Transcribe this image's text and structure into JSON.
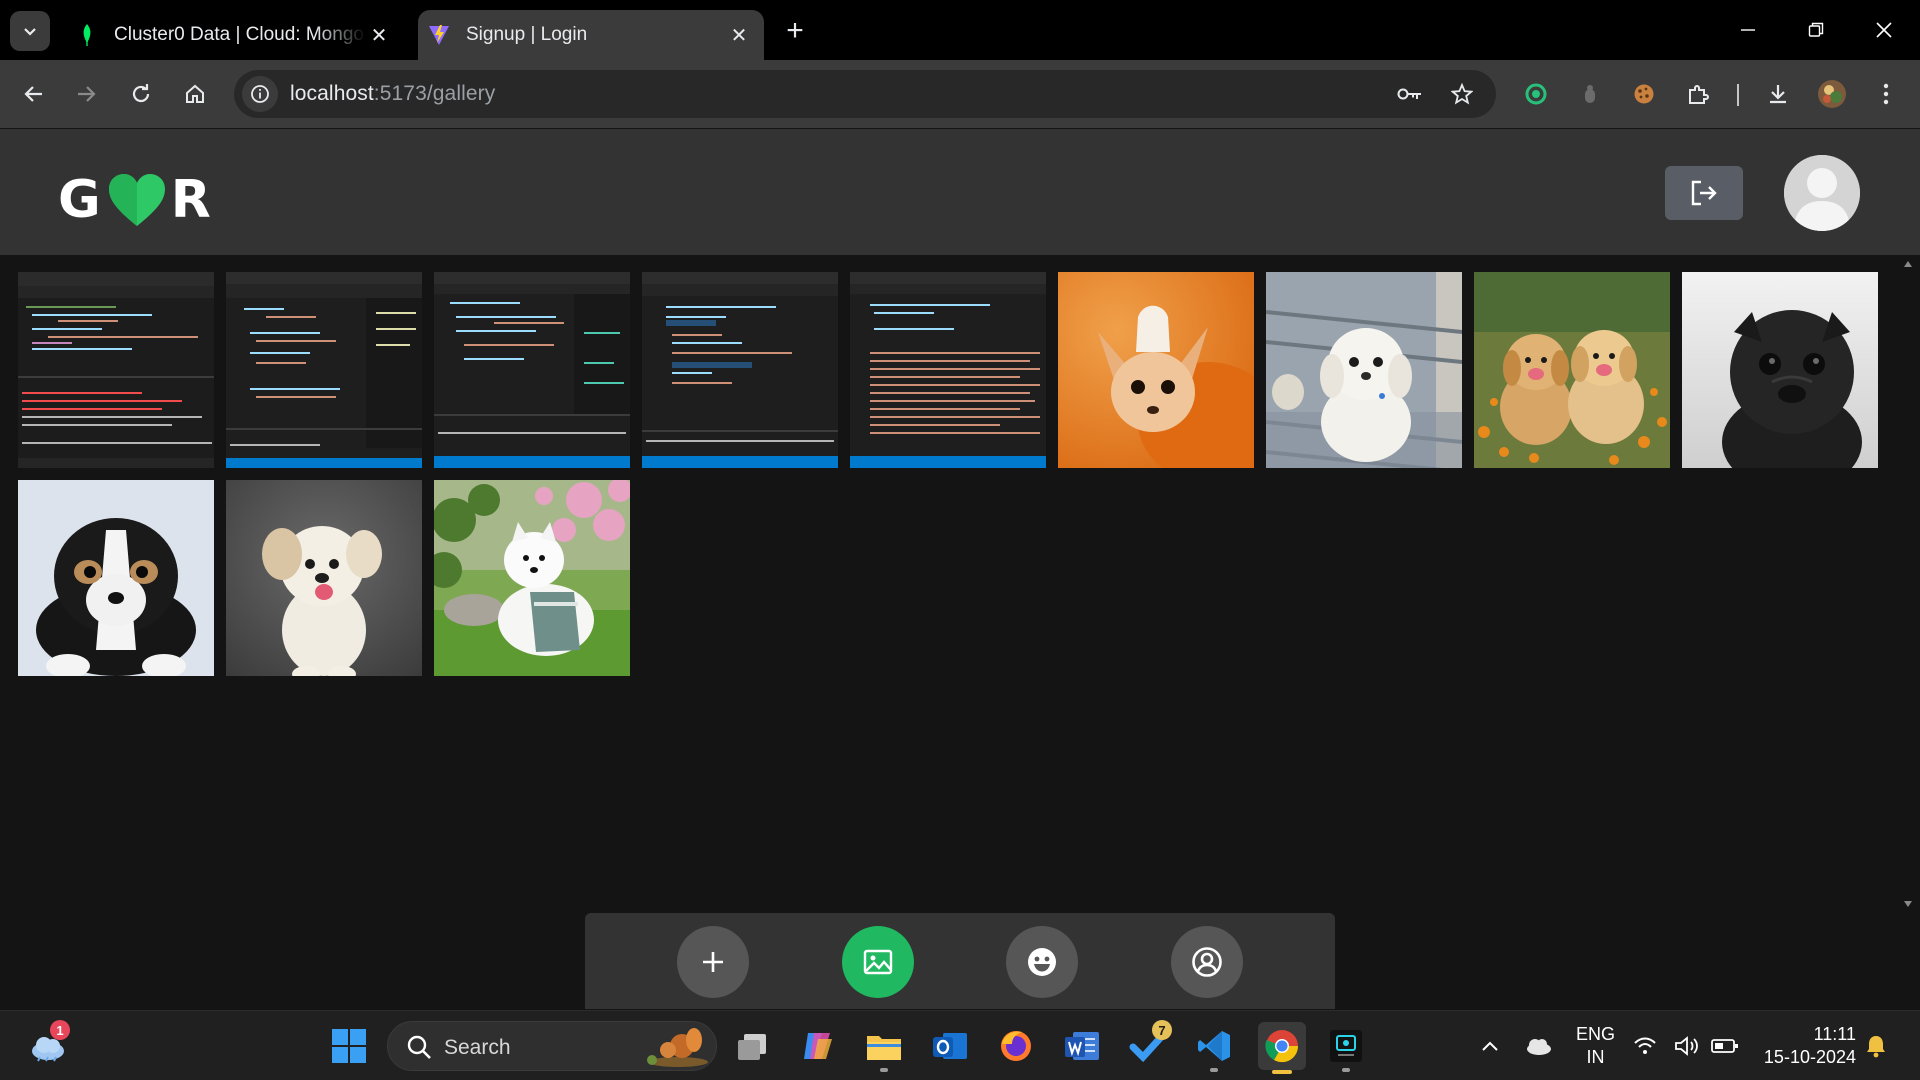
{
  "browser": {
    "tabs": [
      {
        "title": "Cluster0 Data | Cloud: MongoDB Cloud",
        "favicon": "mongodb-leaf-icon",
        "active": false
      },
      {
        "title": "Signup | Login",
        "favicon": "vite-logo-icon",
        "active": true
      }
    ],
    "address": {
      "host": "localhost",
      "path": ":5173/gallery"
    }
  },
  "app": {
    "logo": {
      "left_letter": "G",
      "right_letter": "R",
      "heart_color": "#2ec866"
    },
    "accent_color": "#20b860",
    "gallery": [
      {
        "kind": "code-screenshot",
        "description": "code-1"
      },
      {
        "kind": "code-screenshot",
        "description": "code-2"
      },
      {
        "kind": "code-screenshot",
        "description": "code-3"
      },
      {
        "kind": "code-screenshot",
        "description": "code-4"
      },
      {
        "kind": "code-screenshot",
        "description": "code-5"
      },
      {
        "kind": "photo",
        "description": "chihuahua"
      },
      {
        "kind": "photo",
        "description": "white-dog-on-chair"
      },
      {
        "kind": "photo",
        "description": "two-golden-puppies"
      },
      {
        "kind": "photo",
        "description": "black-pug"
      },
      {
        "kind": "photo",
        "description": "black-white-puppy"
      },
      {
        "kind": "photo",
        "description": "fluffy-white-dog"
      },
      {
        "kind": "photo",
        "description": "samoyed-in-garden"
      }
    ],
    "bottom_nav": [
      {
        "icon": "plus-icon",
        "active": false
      },
      {
        "icon": "image-icon",
        "active": true
      },
      {
        "icon": "smiley-icon",
        "active": false
      },
      {
        "icon": "user-circle-icon",
        "active": false
      }
    ]
  },
  "taskbar": {
    "search_label": "Search",
    "weather_badge": "1",
    "todo_badge": "7",
    "language": {
      "line1": "ENG",
      "line2": "IN"
    },
    "time": "11:11",
    "date": "15-10-2024"
  }
}
